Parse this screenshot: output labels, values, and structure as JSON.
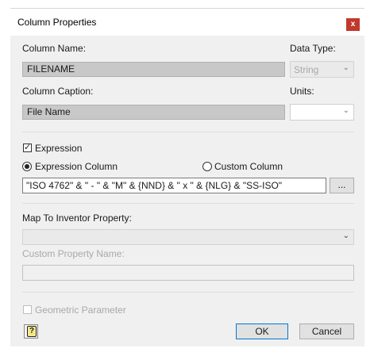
{
  "window": {
    "title": "Column Properties",
    "close_glyph": "x"
  },
  "column_name": {
    "label": "Column Name:",
    "value": "FILENAME"
  },
  "data_type": {
    "label": "Data Type:",
    "value": "String"
  },
  "column_caption": {
    "label": "Column Caption:",
    "value": "File Name"
  },
  "units": {
    "label": "Units:",
    "value": ""
  },
  "expression": {
    "checkbox_label": "Expression",
    "checked": true
  },
  "mode": {
    "expression_column_label": "Expression Column",
    "custom_column_label": "Custom Column",
    "selected": "Expression Column"
  },
  "expression_value": "\"ISO 4762\" & \" - \" & \"M\" & {NND} & \" x \" & {NLG} & \"SS-ISO\"",
  "browse_label": "...",
  "map_to": {
    "label": "Map To Inventor Property:",
    "value": ""
  },
  "custom_property": {
    "label": "Custom Property Name:",
    "value": ""
  },
  "geometric": {
    "label": "Geometric Parameter",
    "checked": false
  },
  "buttons": {
    "ok": "OK",
    "cancel": "Cancel",
    "help_glyph": "?"
  },
  "icons": [
    "close-icon",
    "chevron-down-icon",
    "checkmark-icon",
    "help-icon"
  ]
}
